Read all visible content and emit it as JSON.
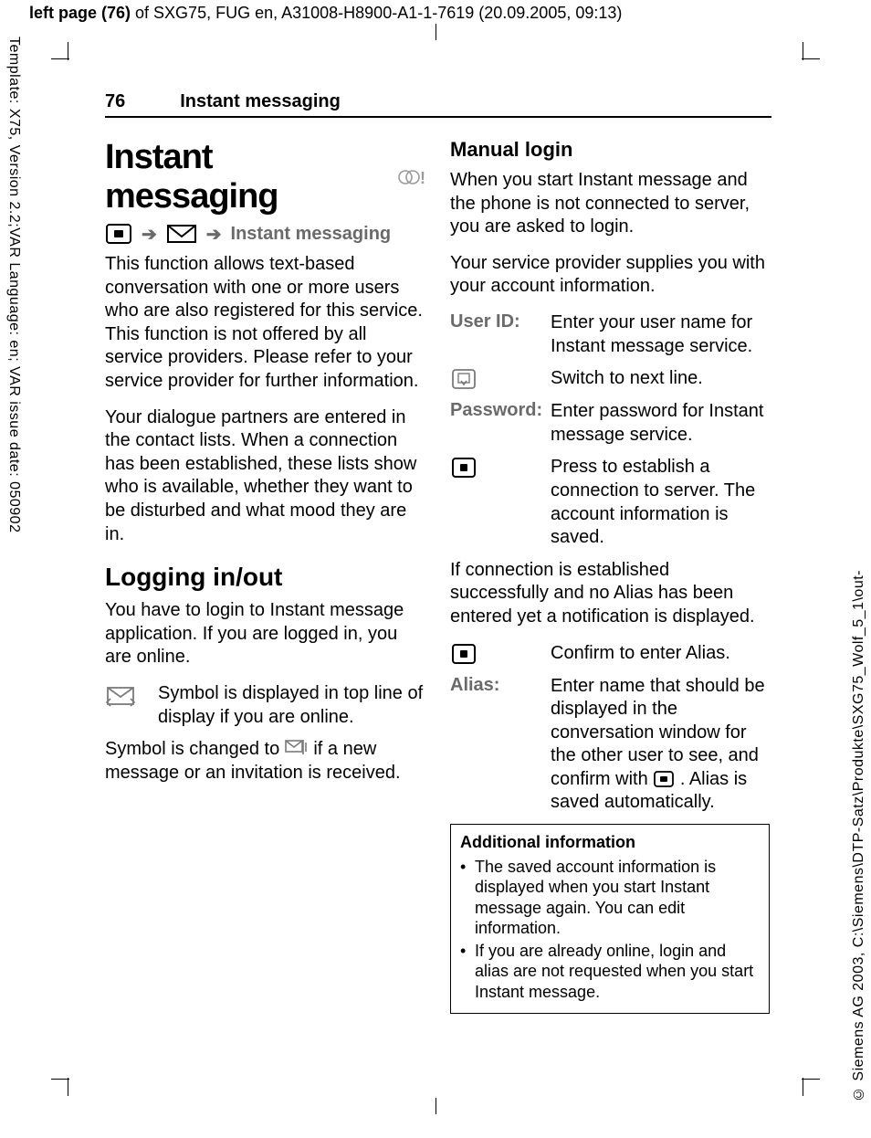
{
  "meta": {
    "topbar_prefix": "left page (76)",
    "topbar_rest": " of SXG75, FUG en, A31008-H8900-A1-1-7619 (20.09.2005, 09:13)",
    "left_vertical": "Template: X75, Version 2.2;VAR Language: en; VAR issue date: 050902",
    "right_vertical": "© Siemens AG 2003, C:\\Siemens\\DTP-Satz\\Produkte\\SXG75_Wolf_5_1\\out-"
  },
  "header": {
    "page_number": "76",
    "section": "Instant messaging"
  },
  "left": {
    "title": "Instant messaging",
    "nav_label": "Instant messaging",
    "intro1": "This function allows text-based conversation with one or more users who are also registered for this service. This function is not offered by all service providers. Please refer to your service provider for further information.",
    "intro2": "Your dialogue partners are entered in the contact lists. When a connection has been established, these lists show who is available, whether they want to be disturbed and what mood they are in.",
    "h2": "Logging in/out",
    "login_intro": "You have to login to Instant message application. If you are logged in, you are online.",
    "sym_online": "Symbol is displayed in top line of display if you are online.",
    "sym_changed_a": "Symbol is changed to ",
    "sym_changed_b": " if a new message or an invitation is received."
  },
  "right": {
    "h3": "Manual login",
    "p1": "When you start Instant message and the phone is not connected to server, you are asked to login.",
    "p2": "Your service provider supplies you with your account information.",
    "user_id_term": "User ID:",
    "user_id_def": "Enter your user name for Instant message service.",
    "switch_def": "Switch to next line.",
    "password_term": "Password:",
    "password_def": "Enter password for Instant message service.",
    "press_def": "Press to establish a connection to server. The account information is saved.",
    "p3": "If connection is established successfully and no Alias has been entered yet a notification is displayed.",
    "confirm_def": "Confirm to enter Alias.",
    "alias_term": "Alias:",
    "alias_def_a": "Enter name that should be displayed in the conversation window for the other user to see, and confirm with ",
    "alias_def_b": ". Alias is saved automatically.",
    "infobox_title": "Additional information",
    "info1": "The saved account information is displayed when you start Instant message again. You can edit information.",
    "info2": "If you are already online, login and alias are not requested when you start Instant message."
  }
}
